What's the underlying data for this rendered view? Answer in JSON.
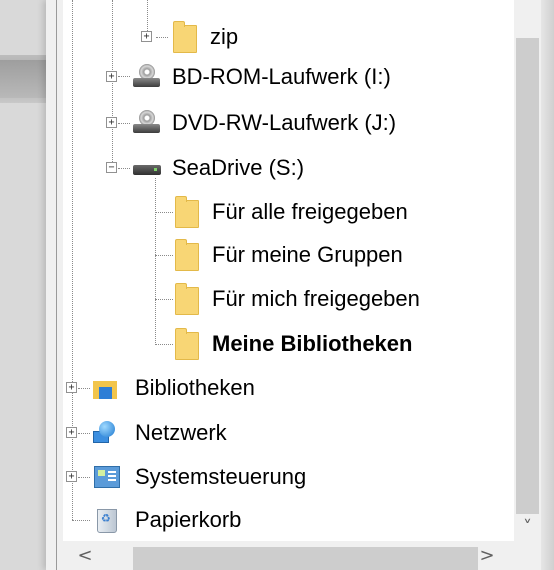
{
  "tree": {
    "items": [
      {
        "label": "zip",
        "icon": "folder-icon",
        "expander": "+"
      },
      {
        "label": "BD-ROM-Laufwerk (I:)",
        "icon": "optical-drive-icon",
        "expander": "+"
      },
      {
        "label": "DVD-RW-Laufwerk (J:)",
        "icon": "optical-drive-icon",
        "expander": "+"
      },
      {
        "label": "SeaDrive (S:)",
        "icon": "drive-icon",
        "expander": "−"
      },
      {
        "label": "Für alle freigegeben",
        "icon": "folder-icon"
      },
      {
        "label": "Für meine Gruppen",
        "icon": "folder-icon"
      },
      {
        "label": "Für mich freigegeben",
        "icon": "folder-icon"
      },
      {
        "label": "Meine Bibliotheken",
        "icon": "folder-icon",
        "selected_bold": true
      },
      {
        "label": "Bibliotheken",
        "icon": "libraries-icon",
        "expander": "+"
      },
      {
        "label": "Netzwerk",
        "icon": "network-icon",
        "expander": "+"
      },
      {
        "label": "Systemsteuerung",
        "icon": "control-panel-icon",
        "expander": "+"
      },
      {
        "label": "Papierkorb",
        "icon": "recycle-bin-icon"
      }
    ]
  },
  "scrollbars": {
    "up_arrow": "˄",
    "down_arrow": "˅",
    "left_arrow": "<",
    "right_arrow": ">"
  }
}
